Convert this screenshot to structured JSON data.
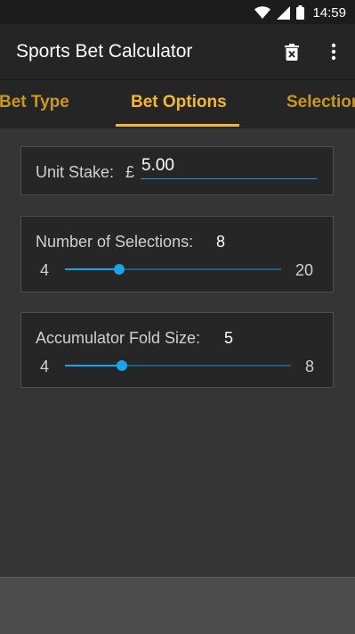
{
  "status_bar": {
    "time": "14:59",
    "icons": [
      "wifi-icon",
      "signal-icon",
      "battery-icon"
    ]
  },
  "toolbar": {
    "title": "Sports Bet Calculator",
    "delete_icon": "delete-icon",
    "menu_icon": "more-vert-icon"
  },
  "tabs": [
    {
      "label": "Bet Type",
      "active": false
    },
    {
      "label": "Bet Options",
      "active": true
    },
    {
      "label": "Selection",
      "active": false
    }
  ],
  "unit_stake": {
    "label": "Unit Stake:",
    "currency": "£",
    "value": "5.00"
  },
  "selections": {
    "label": "Number of Selections:",
    "value": "8",
    "min": "4",
    "max": "20",
    "current": 8
  },
  "fold_size": {
    "label": "Accumulator Fold Size:",
    "value": "5",
    "min": "4",
    "max": "8",
    "current": 5
  },
  "colors": {
    "accent": "#f5b82c",
    "slider": "#19a5eb",
    "background": "#353535",
    "card": "#262626"
  }
}
